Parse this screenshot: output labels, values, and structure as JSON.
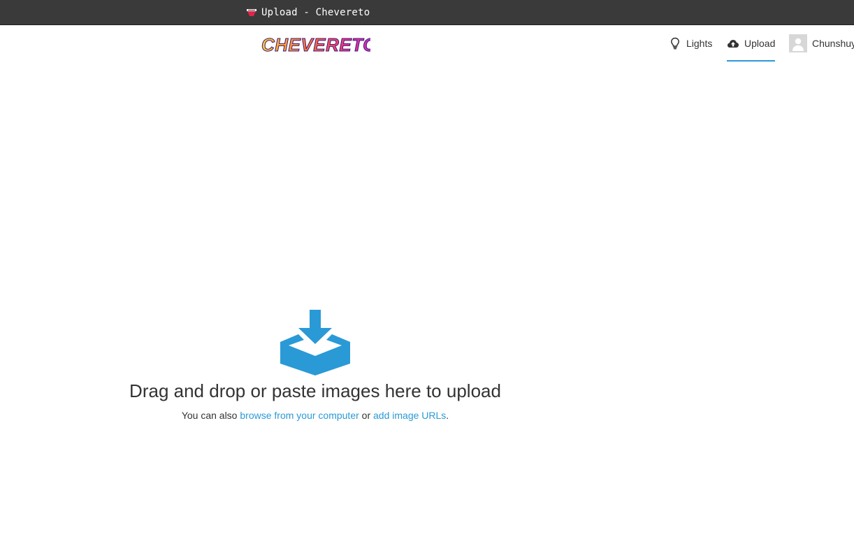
{
  "window": {
    "tab_title": "Upload - Chevereto",
    "favicon": "chevereto-favicon"
  },
  "header": {
    "logo_text": "CHEVERETO",
    "nav": {
      "lights_label": "Lights",
      "lights_icon": "lightbulb-icon",
      "upload_label": "Upload",
      "upload_icon": "cloud-upload-icon",
      "user_label": "Chunshuy",
      "user_icon": "user-avatar"
    },
    "active_color": "#2a9ad6"
  },
  "dropzone": {
    "icon": "tray-download-icon",
    "heading": "Drag and drop or paste images here to upload",
    "sub_prefix": "You can also",
    "browse_link": "browse from your computer",
    "sub_middle": "or",
    "urls_link": "add image URLs",
    "sub_suffix": ".",
    "accent_color": "#2a9ad6"
  }
}
